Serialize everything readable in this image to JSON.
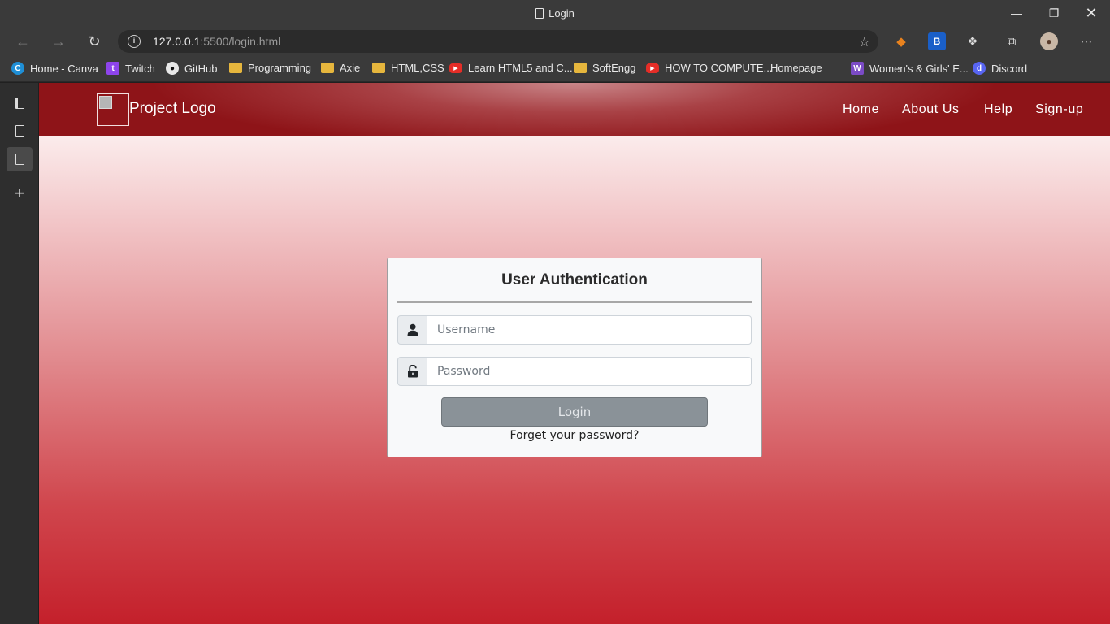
{
  "window": {
    "title": "Login"
  },
  "toolbar": {
    "url_host": "127.0.0.1",
    "url_rest": ":5500/login.html"
  },
  "bookmarks": [
    {
      "label": "Home - Canva",
      "icon": "canva-icon"
    },
    {
      "label": "Twitch",
      "icon": "twitch-icon"
    },
    {
      "label": "GitHub",
      "icon": "github-icon"
    },
    {
      "label": "Programming",
      "icon": "folder-icon"
    },
    {
      "label": "Axie",
      "icon": "folder-icon"
    },
    {
      "label": "HTML,CSS",
      "icon": "folder-icon"
    },
    {
      "label": "Learn HTML5 and C...",
      "icon": "youtube-icon"
    },
    {
      "label": "SoftEngg",
      "icon": "folder-icon"
    },
    {
      "label": "HOW TO COMPUTE...",
      "icon": "youtube-icon"
    },
    {
      "label": "Homepage",
      "icon": "page-icon"
    },
    {
      "label": "Women's & Girls' E...",
      "icon": "wg-icon"
    },
    {
      "label": "Discord",
      "icon": "discord-icon"
    }
  ],
  "navbar": {
    "logo_text": "Project Logo",
    "links": [
      "Home",
      "About Us",
      "Help",
      "Sign-up"
    ]
  },
  "login_card": {
    "title": "User Authentication",
    "username_placeholder": "Username",
    "password_placeholder": "Password",
    "login_label": "Login",
    "forgot_label": "Forget your password?"
  }
}
